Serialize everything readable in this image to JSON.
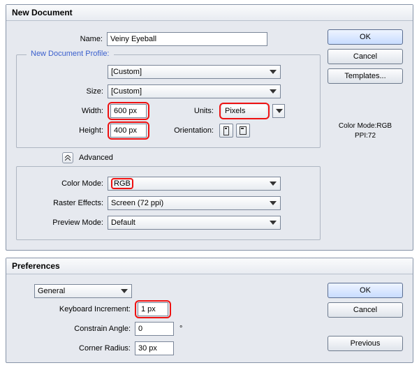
{
  "newdoc": {
    "title": "New Document",
    "labels": {
      "name": "Name:",
      "profile": "New Document Profile:",
      "size": "Size:",
      "width": "Width:",
      "height": "Height:",
      "units": "Units:",
      "orientation": "Orientation:",
      "advanced": "Advanced",
      "colorMode": "Color Mode:",
      "rasterEffects": "Raster Effects:",
      "previewMode": "Preview Mode:"
    },
    "values": {
      "name": "Veiny Eyeball",
      "profile": "[Custom]",
      "size": "[Custom]",
      "width": "600 px",
      "height": "400 px",
      "units": "Pixels",
      "colorMode": "RGB",
      "rasterEffects": "Screen (72 ppi)",
      "previewMode": "Default"
    },
    "buttons": {
      "ok": "OK",
      "cancel": "Cancel",
      "templates": "Templates..."
    },
    "meta": {
      "line1": "Color Mode:RGB",
      "line2": "PPI:72"
    }
  },
  "prefs": {
    "title": "Preferences",
    "category": "General",
    "labels": {
      "keyboardIncrement": "Keyboard Increment:",
      "constrainAngle": "Constrain Angle:",
      "cornerRadius": "Corner Radius:"
    },
    "values": {
      "keyboardIncrement": "1 px",
      "constrainAngle": "0",
      "cornerRadius": "30 px"
    },
    "buttons": {
      "ok": "OK",
      "cancel": "Cancel",
      "previous": "Previous"
    }
  }
}
